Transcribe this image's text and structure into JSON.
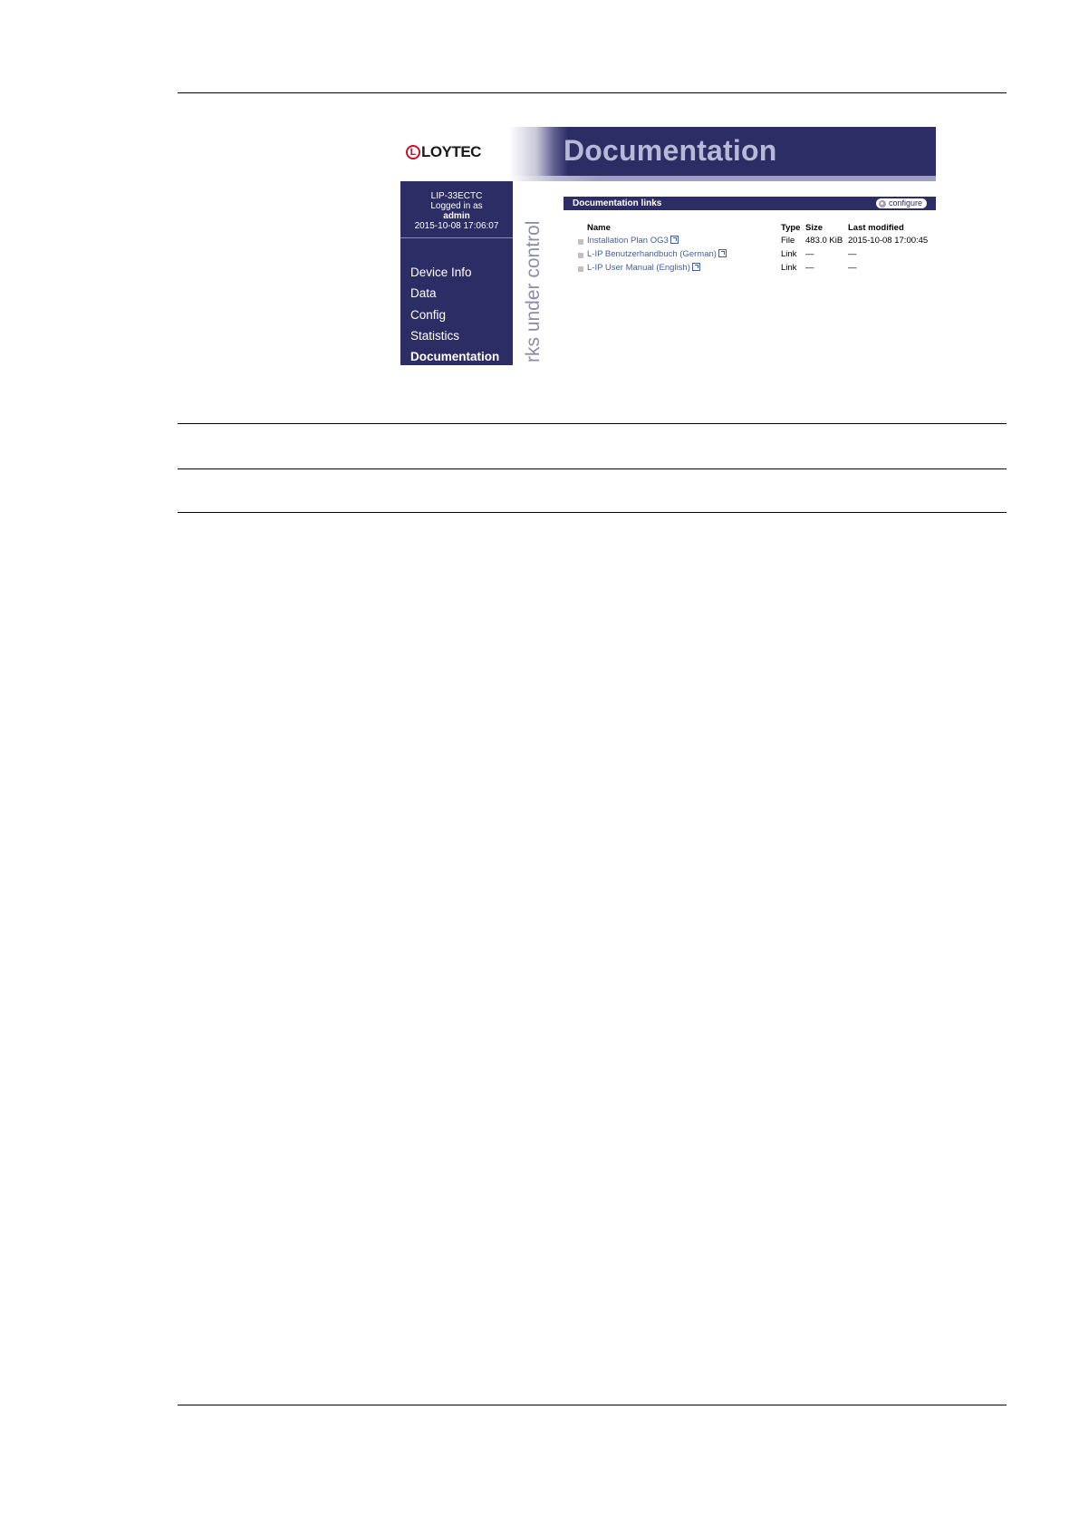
{
  "window": {
    "logo_text": "LOYTEC",
    "page_heading": "Documentation",
    "slogan": "rks under control"
  },
  "sidebar": {
    "device_name": "LIP-33ECTC",
    "logged_in_label": "Logged in as",
    "user": "admin",
    "timestamp": "2015-10-08 17:06:07",
    "nav": [
      {
        "label": "Device Info",
        "active": false
      },
      {
        "label": "Data",
        "active": false
      },
      {
        "label": "Config",
        "active": false
      },
      {
        "label": "Statistics",
        "active": false
      },
      {
        "label": "Documentation",
        "active": true
      }
    ]
  },
  "panel": {
    "title": "Documentation links",
    "configure_label": "configure"
  },
  "table": {
    "headers": {
      "name": "Name",
      "type": "Type",
      "size": "Size",
      "modified": "Last modified"
    },
    "rows": [
      {
        "name": "Installation Plan OG3",
        "type": "File",
        "size": "483.0 KiB",
        "modified": "2015-10-08 17:00:45"
      },
      {
        "name": "L-IP Benutzerhandbuch (German)",
        "type": "Link",
        "size": "—",
        "modified": "—"
      },
      {
        "name": "L-IP User Manual (English)",
        "type": "Link",
        "size": "—",
        "modified": "—"
      }
    ]
  },
  "colors": {
    "navy": "#2d2d66",
    "heading_lavender": "#b8b9d6",
    "link_blue": "#3f5fa8",
    "logo_red": "#c8102e"
  }
}
